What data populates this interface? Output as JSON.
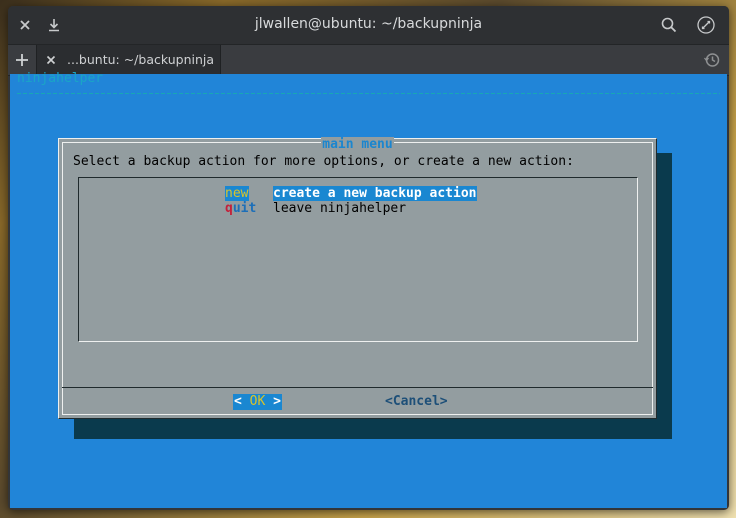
{
  "window": {
    "title": "jlwallen@ubuntu: ~/backupninja",
    "tab_label": "...buntu: ~/backupninja"
  },
  "icons": {
    "close": "close-icon",
    "download": "download-icon",
    "search": "search-icon",
    "maximize": "maximize-icon",
    "new_tab": "plus-icon",
    "tab_close": "close-icon",
    "history": "history-icon"
  },
  "terminal": {
    "header": "ninjahelper"
  },
  "dialog": {
    "title": "main menu",
    "prompt": "Select a backup action for more options, or create a new action:",
    "items": [
      {
        "tag_first": "n",
        "tag_rest": "ew",
        "description": "create a new backup action",
        "selected": true
      },
      {
        "tag_first": "q",
        "tag_rest": "uit",
        "description": "leave ninjahelper",
        "selected": false
      }
    ],
    "ok_left": "< ",
    "ok_label": "OK",
    "ok_right": " >",
    "cancel_label": "<Cancel>"
  },
  "colors": {
    "terminal_bg": "#2185d8",
    "dialog_bg": "#939da0",
    "highlight": "#1a87d1",
    "hotkey_yellow": "#d9c42a",
    "hotkey_red": "#c3213b"
  }
}
